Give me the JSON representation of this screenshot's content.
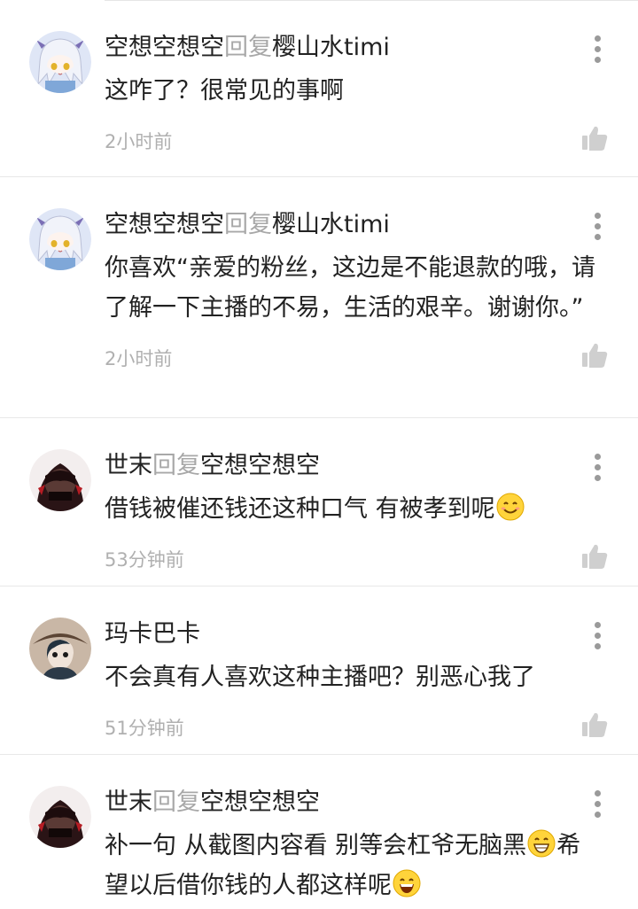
{
  "comments": [
    {
      "author": "空想空想空",
      "reply_word": "回复",
      "reply_to": "樱山水timi",
      "text": "这咋了？很常见的事啊",
      "time": "2小时前",
      "avatar_icon": "anime-girl-avatar"
    },
    {
      "author": "空想空想空",
      "reply_word": "回复",
      "reply_to": "樱山水timi",
      "text": "你喜欢“亲爱的粉丝，这边是不能退款的哦，请了解一下主播的不易，生活的艰辛。谢谢你。”",
      "time": "2小时前",
      "avatar_icon": "anime-girl-avatar"
    },
    {
      "author": "世末",
      "reply_word": "回复",
      "reply_to": "空想空想空",
      "text": "借钱被催还钱还这种口气 有被孝到呢",
      "text_emoji": "smile-emoji",
      "time": "53分钟前",
      "avatar_icon": "dark-hooded-avatar"
    },
    {
      "author": "玛卡巴卡",
      "text": "不会真有人喜欢这种主播吧？别恶心我了",
      "time": "51分钟前",
      "avatar_icon": "hat-character-avatar"
    },
    {
      "author": "世末",
      "reply_word": "回复",
      "reply_to": "空想空想空",
      "text_part1": "补一句 从截图内容看 别等会杠爷无脑黑",
      "text_emoji1": "grin-emoji",
      "text_part2": "希望以后借你钱的人都这样呢",
      "text_emoji2": "laugh-emoji",
      "avatar_icon": "dark-hooded-avatar"
    }
  ],
  "colors": {
    "text": "#222222",
    "muted": "#a8a8a8",
    "divider": "#e8e8e8"
  }
}
